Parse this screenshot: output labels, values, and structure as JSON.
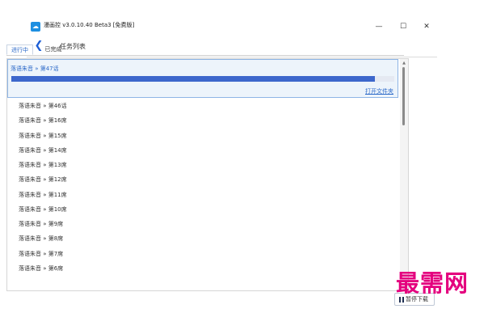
{
  "window": {
    "title": "漫画控 v3.0.10.40 Beta3 [免费版]",
    "logo_glyph": "☁",
    "minimize_glyph": "—",
    "maximize_glyph": "☐",
    "close_glyph": "✕"
  },
  "header": {
    "back_glyph": "❮",
    "title": "任务列表"
  },
  "tabs": [
    {
      "label": "进行中",
      "active": true
    },
    {
      "label": "已完成",
      "active": false
    }
  ],
  "active_task": {
    "name": "落语朱音 » 第47话",
    "progress": 0.95,
    "open_folder_label": "打开文件夹",
    "accent_color": "#3d67cc"
  },
  "tasks": [
    {
      "label": "落语朱音 » 第46话"
    },
    {
      "label": "落语朱音 » 第16席"
    },
    {
      "label": "落语朱音 » 第15席"
    },
    {
      "label": "落语朱音 » 第14席"
    },
    {
      "label": "落语朱音 » 第13席"
    },
    {
      "label": "落语朱音 » 第12席"
    },
    {
      "label": "落语朱音 » 第11席"
    },
    {
      "label": "落语朱音 » 第10席"
    },
    {
      "label": "落语朱音 » 第9席"
    },
    {
      "label": "落语朱音 » 第8席"
    },
    {
      "label": "落语朱音 » 第7席"
    },
    {
      "label": "落语朱音 » 第6席"
    }
  ],
  "scrollbar": {
    "up_glyph": "▲"
  },
  "footer": {
    "pause_label": "暂停下载",
    "pause_icon": "pause-icon"
  },
  "watermark": {
    "text": "最需网",
    "color": "#e4007e"
  }
}
